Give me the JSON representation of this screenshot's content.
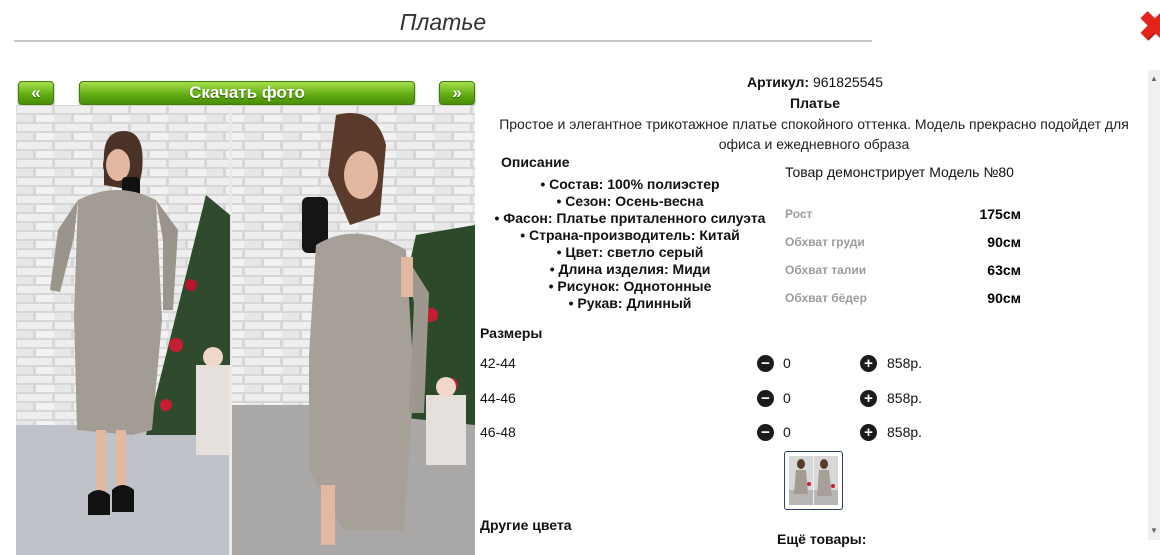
{
  "title": "Платье",
  "close_icon": "close-x-icon",
  "gallery": {
    "prev_label": "«",
    "download_label": "Скачать фото",
    "next_label": "»"
  },
  "product": {
    "article_label": "Артикул:",
    "article_value": "961825545",
    "name": "Платье",
    "description": "Простое и элегантное трикотажное платье спокойного оттенка. Модель прекрасно подойдет для офиса и ежедневного образа",
    "description_title": "Описание",
    "properties": [
      "• Состав: 100% полиэстер",
      "• Сезон: Осень-весна",
      "• Фасон: Платье приталенного силуэта",
      "• Страна-производитель: Китай",
      "• Цвет: светло серый",
      "• Длина изделия: Миди",
      "• Рисунок: Однотонные",
      "• Рукав: Длинный"
    ]
  },
  "model": {
    "title": "Товар демонстрирует Модель №80",
    "measures": [
      {
        "label": "Рост",
        "value": "175см"
      },
      {
        "label": "Обхват груди",
        "value": "90см"
      },
      {
        "label": "Обхват талии",
        "value": "63см"
      },
      {
        "label": "Обхват бёдер",
        "value": "90см"
      }
    ]
  },
  "sizes": {
    "title": "Размеры",
    "minus_symbol": "−",
    "plus_symbol": "+",
    "rows": [
      {
        "size": "42-44",
        "qty": "0",
        "price": "858р."
      },
      {
        "size": "44-46",
        "qty": "0",
        "price": "858р."
      },
      {
        "size": "46-48",
        "qty": "0",
        "price": "858р."
      }
    ]
  },
  "other_colors_label": "Другие цвета",
  "more_products_label": "Ещё товары:",
  "colors": {
    "button_green": "#6bbb13",
    "close_red": "#e4231b",
    "dress_gray": "#a29c95"
  }
}
